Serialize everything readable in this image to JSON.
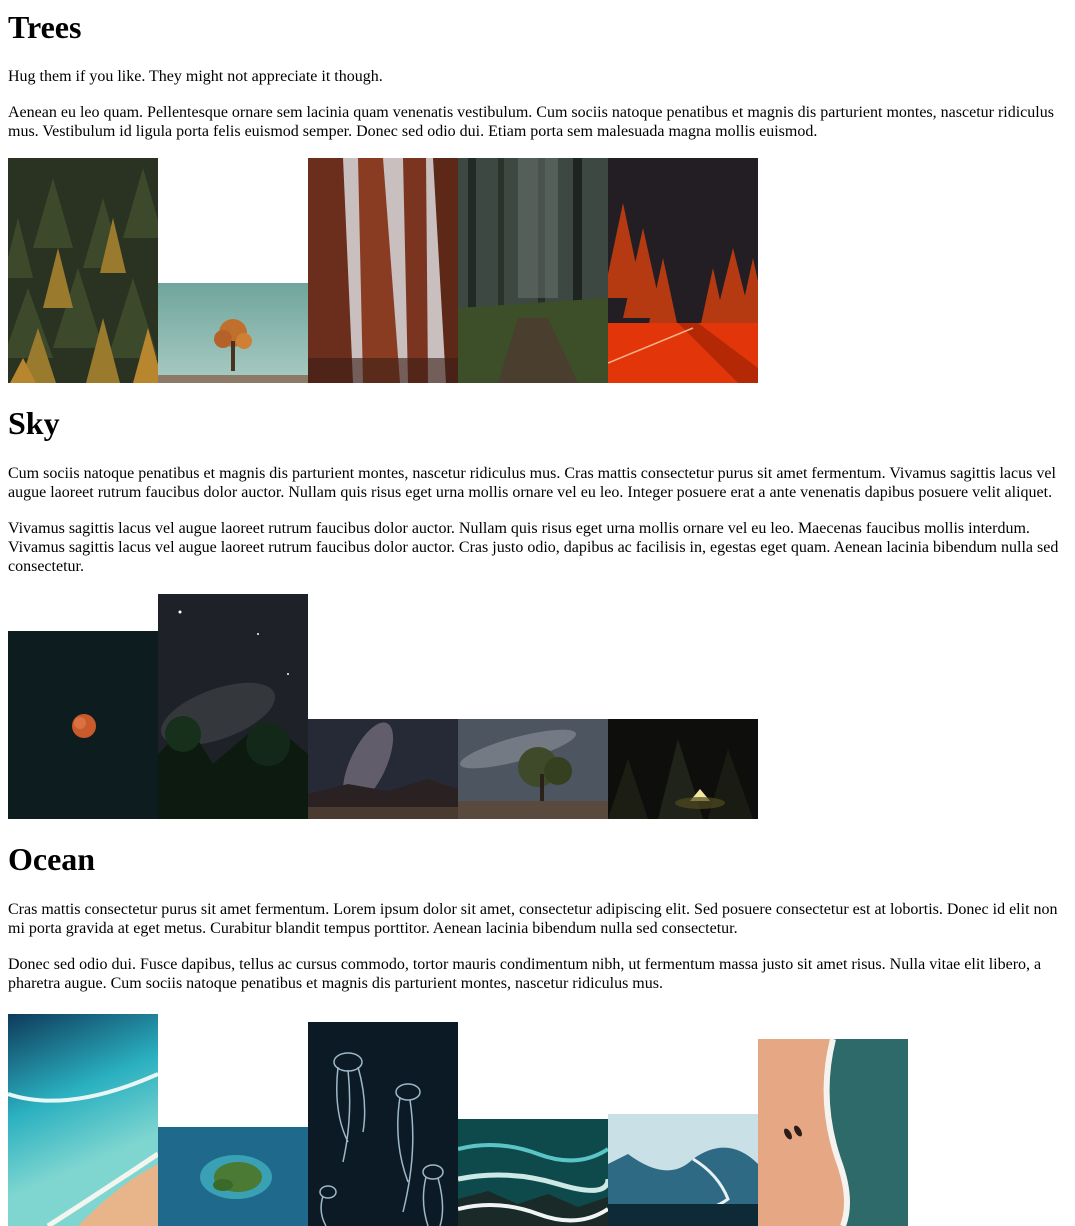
{
  "sections": [
    {
      "title": "Trees",
      "paragraphs": [
        "Hug them if you like. They might not appreciate it though.",
        "Aenean eu leo quam. Pellentesque ornare sem lacinia quam venenatis vestibulum. Cum sociis natoque penatibus et magnis dis parturient montes, nascetur ridiculus mus. Vestibulum id ligula porta felis euismod semper. Donec sed odio dui. Etiam porta sem malesuada magna mollis euismod."
      ]
    },
    {
      "title": "Sky",
      "paragraphs": [
        "Cum sociis natoque penatibus et magnis dis parturient montes, nascetur ridiculus mus. Cras mattis consectetur purus sit amet fermentum. Vivamus sagittis lacus vel augue laoreet rutrum faucibus dolor auctor. Nullam quis risus eget urna mollis ornare vel eu leo. Integer posuere erat a ante venenatis dapibus posuere velit aliquet.",
        "Vivamus sagittis lacus vel augue laoreet rutrum faucibus dolor auctor. Nullam quis risus eget urna mollis ornare vel eu leo. Maecenas faucibus mollis interdum. Vivamus sagittis lacus vel augue laoreet rutrum faucibus dolor auctor. Cras justo odio, dapibus ac facilisis in, egestas eget quam. Aenean lacinia bibendum nulla sed consectetur."
      ]
    },
    {
      "title": "Ocean",
      "paragraphs": [
        "Cras mattis consectetur purus sit amet fermentum. Lorem ipsum dolor sit amet, consectetur adipiscing elit. Sed posuere consectetur est at lobortis. Donec id elit non mi porta gravida at eget metus. Curabitur blandit tempus porttitor. Aenean lacinia bibendum nulla sed consectetur.",
        "Donec sed odio dui. Fusce dapibus, tellus ac cursus commodo, tortor mauris condimentum nibh, ut fermentum massa justo sit amet risus. Nulla vitae elit libero, a pharetra augue. Cum sociis natoque penatibus et magnis dis parturient montes, nascetur ridiculus mus."
      ]
    }
  ],
  "colors": {
    "background": "#ffffff",
    "text": "#000000"
  }
}
